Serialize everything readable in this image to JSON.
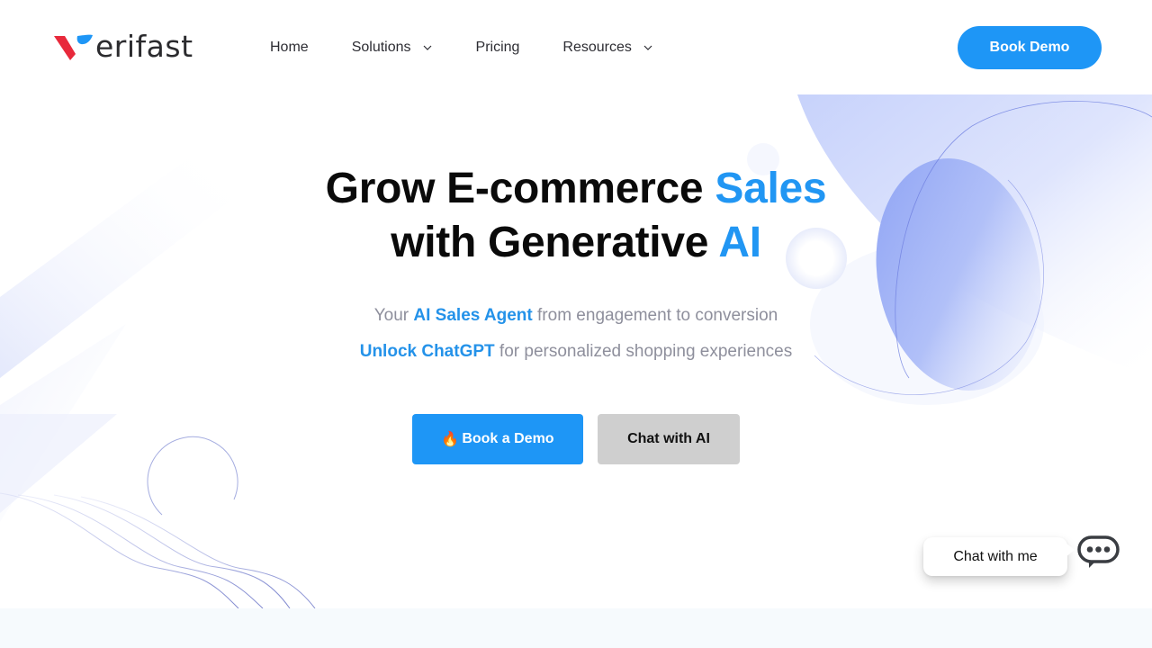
{
  "brand": {
    "logo_text": "erifast",
    "logo_mark": "V",
    "colors": {
      "primary": "#1e96f6",
      "highlight": "#2196f3",
      "logo_red": "#e8293b",
      "logo_blue": "#1e96f6"
    }
  },
  "nav": {
    "items": [
      {
        "label": "Home",
        "has_dropdown": false
      },
      {
        "label": "Solutions",
        "has_dropdown": true
      },
      {
        "label": "Pricing",
        "has_dropdown": false
      },
      {
        "label": "Resources",
        "has_dropdown": true
      }
    ],
    "cta_label": "Book Demo"
  },
  "hero": {
    "title_line1_a": "Grow E-commerce ",
    "title_line1_b": "Sales",
    "title_line2_a": "with Generative ",
    "title_line2_b": "AI",
    "subtitle1_a": "Your ",
    "subtitle1_b": "AI Sales Agent",
    "subtitle1_c": " from engagement to conversion",
    "subtitle2_a": "Unlock ChatGPT",
    "subtitle2_b": " for personalized shopping experiences",
    "primary_cta": {
      "icon": "🔥",
      "label": "Book a Demo"
    },
    "secondary_cta": {
      "label": "Chat with AI"
    }
  },
  "chat_widget": {
    "bubble_label": "Chat with me",
    "icon": "chat-dots-icon"
  }
}
